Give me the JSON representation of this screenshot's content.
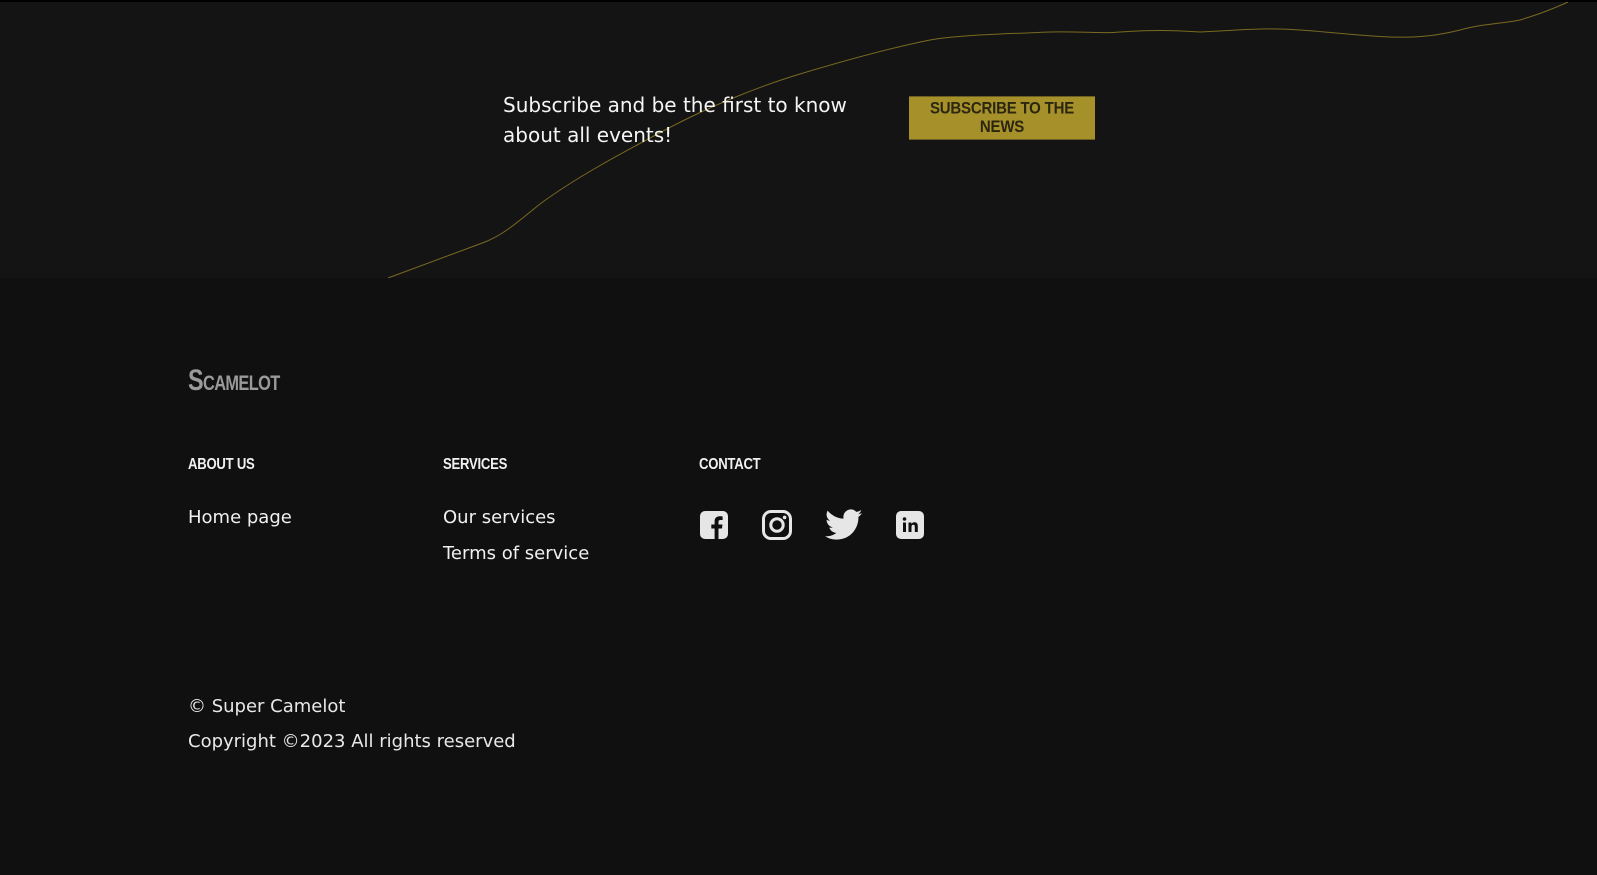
{
  "subscribe": {
    "text": "Subscribe and be the first to know about all events!",
    "button_label": "Subscribe to the news"
  },
  "footer": {
    "logo": "Scamelot",
    "about": {
      "heading": "About us",
      "links": [
        "Home page"
      ]
    },
    "services": {
      "heading": "Services",
      "links": [
        "Our services",
        "Terms of service"
      ]
    },
    "contact": {
      "heading": "Contact",
      "socials": [
        "facebook-icon",
        "instagram-icon",
        "twitter-icon",
        "linkedin-icon"
      ]
    },
    "copyright_line1": "© Super Camelot",
    "copyright_line2": "Copyright ©2023 All rights reserved"
  },
  "colors": {
    "accent": "#a5902a",
    "background": "#101010",
    "band": "#141414"
  }
}
